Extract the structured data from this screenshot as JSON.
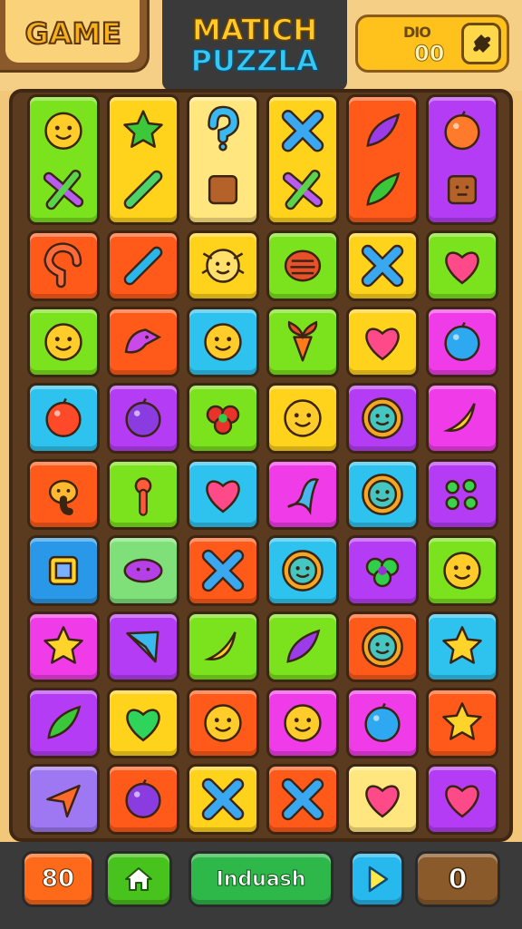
{
  "header": {
    "game_label": "GAME",
    "title_line1": "MATICH",
    "title_line2": "PUZZLA",
    "score_label": "DIO",
    "score_value": "00",
    "score_icon": "puzzle-piece-icon"
  },
  "footer": {
    "moves_label": "80",
    "home_icon": "home-icon",
    "main_button_label": "Induash",
    "play_icon": "play-icon",
    "counter_label": "0"
  },
  "colors": {
    "green": "#7be21e",
    "yellow": "#ffd21c",
    "orange": "#ff5a1a",
    "purple": "#b53cf5",
    "cyan": "#2ec2ee",
    "magenta": "#f03ce8",
    "blue": "#2a98e8",
    "mint": "#7fe07a",
    "lavender": "#9d78f2"
  },
  "tall_row": [
    {
      "color": "green",
      "icons": [
        "smiley-creature",
        "crossed-tools"
      ]
    },
    {
      "color": "yellow",
      "icons": [
        "star-splat",
        "syringe"
      ]
    },
    {
      "color": "pale-yellow",
      "icons": [
        "question-mark",
        "brown-block"
      ]
    },
    {
      "color": "yellow",
      "icons": [
        "x-mark",
        "crossed-tools"
      ]
    },
    {
      "color": "orange",
      "icons": [
        "purple-leaf",
        "green-leaf"
      ]
    },
    {
      "color": "purple",
      "icons": [
        "orange-fruit",
        "box-face"
      ]
    }
  ],
  "grid": [
    [
      {
        "color": "orange",
        "icon": "hook"
      },
      {
        "color": "orange",
        "icon": "stick"
      },
      {
        "color": "yellow",
        "icon": "bug-face"
      },
      {
        "color": "green",
        "icon": "turtle"
      },
      {
        "color": "yellow",
        "icon": "x-mark"
      },
      {
        "color": "green",
        "icon": "heart"
      }
    ],
    [
      {
        "color": "green",
        "icon": "smiley"
      },
      {
        "color": "orange",
        "icon": "bird"
      },
      {
        "color": "cyan",
        "icon": "smiley"
      },
      {
        "color": "green",
        "icon": "carrot"
      },
      {
        "color": "yellow",
        "icon": "heart"
      },
      {
        "color": "magenta",
        "icon": "blue-ball"
      }
    ],
    [
      {
        "color": "cyan",
        "icon": "apple"
      },
      {
        "color": "purple",
        "icon": "plum"
      },
      {
        "color": "green",
        "icon": "red-splat"
      },
      {
        "color": "yellow",
        "icon": "smiley"
      },
      {
        "color": "purple",
        "icon": "sun-face"
      },
      {
        "color": "magenta",
        "icon": "banana"
      }
    ],
    [
      {
        "color": "orange",
        "icon": "elephant"
      },
      {
        "color": "green",
        "icon": "key"
      },
      {
        "color": "cyan",
        "icon": "heart"
      },
      {
        "color": "magenta",
        "icon": "ghost"
      },
      {
        "color": "cyan",
        "icon": "sun-face"
      },
      {
        "color": "purple",
        "icon": "green-balls"
      }
    ],
    [
      {
        "color": "blue",
        "icon": "frame"
      },
      {
        "color": "mint",
        "icon": "purple-blob"
      },
      {
        "color": "orange",
        "icon": "x-mark"
      },
      {
        "color": "cyan",
        "icon": "sun-face"
      },
      {
        "color": "purple",
        "icon": "clover"
      },
      {
        "color": "green",
        "icon": "smiley"
      }
    ],
    [
      {
        "color": "magenta",
        "icon": "star"
      },
      {
        "color": "purple",
        "icon": "gem"
      },
      {
        "color": "green",
        "icon": "banana"
      },
      {
        "color": "green",
        "icon": "purple-leaf"
      },
      {
        "color": "orange",
        "icon": "sun-face"
      },
      {
        "color": "cyan",
        "icon": "star"
      }
    ],
    [
      {
        "color": "purple",
        "icon": "green-leaf"
      },
      {
        "color": "yellow",
        "icon": "green-heart"
      },
      {
        "color": "orange",
        "icon": "smiley"
      },
      {
        "color": "magenta",
        "icon": "smiley"
      },
      {
        "color": "magenta",
        "icon": "blue-ball"
      },
      {
        "color": "orange",
        "icon": "star"
      }
    ],
    [
      {
        "color": "lavender",
        "icon": "arrow"
      },
      {
        "color": "orange",
        "icon": "plum"
      },
      {
        "color": "yellow",
        "icon": "x-mark"
      },
      {
        "color": "orange",
        "icon": "x-mark"
      },
      {
        "color": "pale-yellow",
        "icon": "heart"
      },
      {
        "color": "purple",
        "icon": "heart"
      }
    ]
  ]
}
